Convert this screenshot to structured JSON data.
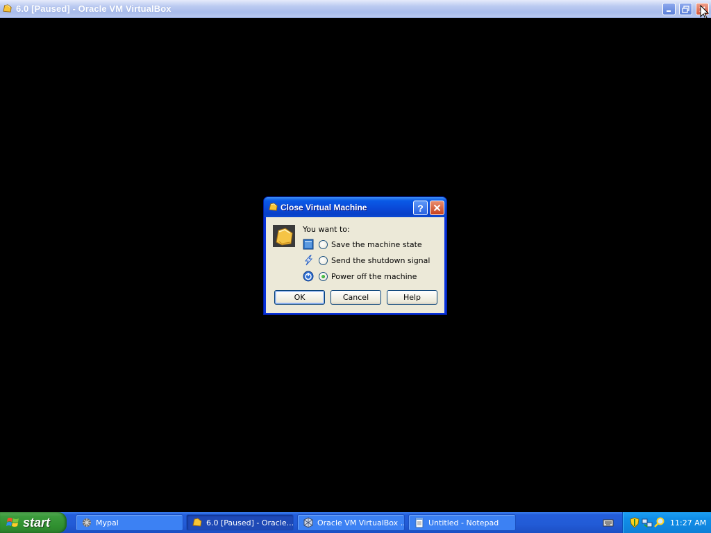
{
  "main_window": {
    "title": "6.0 [Paused] - Oracle VM VirtualBox",
    "controls": [
      "minimize-icon",
      "restore-icon",
      "close-icon"
    ]
  },
  "dialog": {
    "title": "Close Virtual Machine",
    "prompt": "You want to:",
    "options": [
      {
        "label": "Save the machine state",
        "icon": "save-state-icon",
        "checked": false
      },
      {
        "label": "Send the shutdown signal",
        "icon": "acpi-shutdown-icon",
        "checked": false
      },
      {
        "label": "Power off the machine",
        "icon": "power-off-icon",
        "checked": true
      }
    ],
    "buttons": {
      "ok": "OK",
      "cancel": "Cancel",
      "help": "Help"
    }
  },
  "taskbar": {
    "start_label": "start",
    "tasks": [
      {
        "label": "Mypal",
        "icon": "mypal-icon",
        "active": false
      },
      {
        "label": "6.0 [Paused] - Oracle...",
        "icon": "virtualbox-vm-icon",
        "active": true
      },
      {
        "label": "Oracle VM VirtualBox ...",
        "icon": "virtualbox-manager-icon",
        "active": false
      },
      {
        "label": "Untitled - Notepad",
        "icon": "notepad-icon",
        "active": false
      }
    ],
    "clock": "11:27 AM",
    "tray_icons": [
      "security-shield-icon",
      "network-icon",
      "search-icon"
    ]
  },
  "colors": {
    "desktop": "#000000",
    "dialog_title": "#0a49d8",
    "dialog_body": "#ece9d8",
    "taskbar": "#245edb",
    "start": "#3c9b3c",
    "tray": "#0f86e0"
  }
}
